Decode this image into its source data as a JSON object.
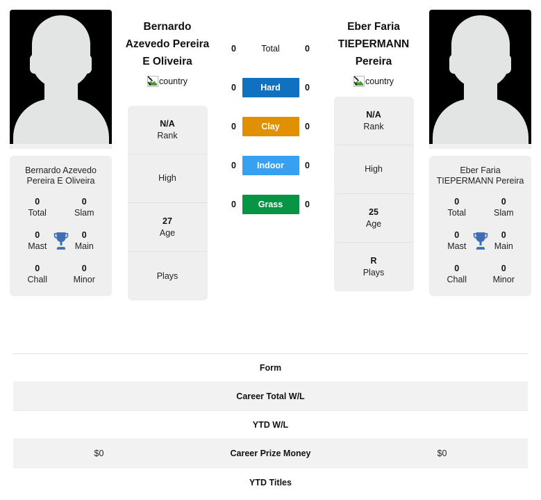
{
  "colors": {
    "hard": "#1071c0",
    "clay": "#e09000",
    "indoor": "#38a0f0",
    "grass": "#089445",
    "trophy": "#3f6eb5",
    "card_bg": "#efefef",
    "row_shaded": "#f2f2f2"
  },
  "left_player": {
    "name": "Bernardo Azevedo Pereira E Oliveira",
    "name_card": "Bernardo Azevedo Pereira E Oliveira",
    "country_alt": "country",
    "avatar_alt": "player photo",
    "info": [
      {
        "value": "N/A",
        "label": "Rank"
      },
      {
        "value": "",
        "label": "High"
      },
      {
        "value": "27",
        "label": "Age"
      },
      {
        "value": "",
        "label": "Plays"
      }
    ],
    "titles": [
      {
        "value": "0",
        "label": "Total"
      },
      {
        "value": "0",
        "label": "Slam"
      },
      {
        "value": "0",
        "label": "Mast"
      },
      {
        "value": "0",
        "label": "Main"
      },
      {
        "value": "0",
        "label": "Chall"
      },
      {
        "value": "0",
        "label": "Minor"
      }
    ]
  },
  "right_player": {
    "name": "Eber Faria TIEPERMANN Pereira",
    "name_card": "Eber Faria TIEPERMANN Pereira",
    "country_alt": "country",
    "avatar_alt": "player photo",
    "info": [
      {
        "value": "N/A",
        "label": "Rank"
      },
      {
        "value": "",
        "label": "High"
      },
      {
        "value": "25",
        "label": "Age"
      },
      {
        "value": "R",
        "label": "Plays"
      }
    ],
    "titles": [
      {
        "value": "0",
        "label": "Total"
      },
      {
        "value": "0",
        "label": "Slam"
      },
      {
        "value": "0",
        "label": "Mast"
      },
      {
        "value": "0",
        "label": "Main"
      },
      {
        "value": "0",
        "label": "Chall"
      },
      {
        "value": "0",
        "label": "Minor"
      }
    ]
  },
  "surfaces": [
    {
      "label": "Total",
      "left": "0",
      "right": "0",
      "color": "",
      "filled": false
    },
    {
      "label": "Hard",
      "left": "0",
      "right": "0",
      "color": "#1071c0",
      "filled": true
    },
    {
      "label": "Clay",
      "left": "0",
      "right": "0",
      "color": "#e09000",
      "filled": true
    },
    {
      "label": "Indoor",
      "left": "0",
      "right": "0",
      "color": "#38a0f0",
      "filled": true
    },
    {
      "label": "Grass",
      "left": "0",
      "right": "0",
      "color": "#089445",
      "filled": true
    }
  ],
  "comparison_rows": [
    {
      "left": "",
      "label": "Form",
      "right": "",
      "shaded": false
    },
    {
      "left": "",
      "label": "Career Total W/L",
      "right": "",
      "shaded": true
    },
    {
      "left": "",
      "label": "YTD W/L",
      "right": "",
      "shaded": false
    },
    {
      "left": "$0",
      "label": "Career Prize Money",
      "right": "$0",
      "shaded": true
    },
    {
      "left": "",
      "label": "YTD Titles",
      "right": "",
      "shaded": false
    }
  ]
}
